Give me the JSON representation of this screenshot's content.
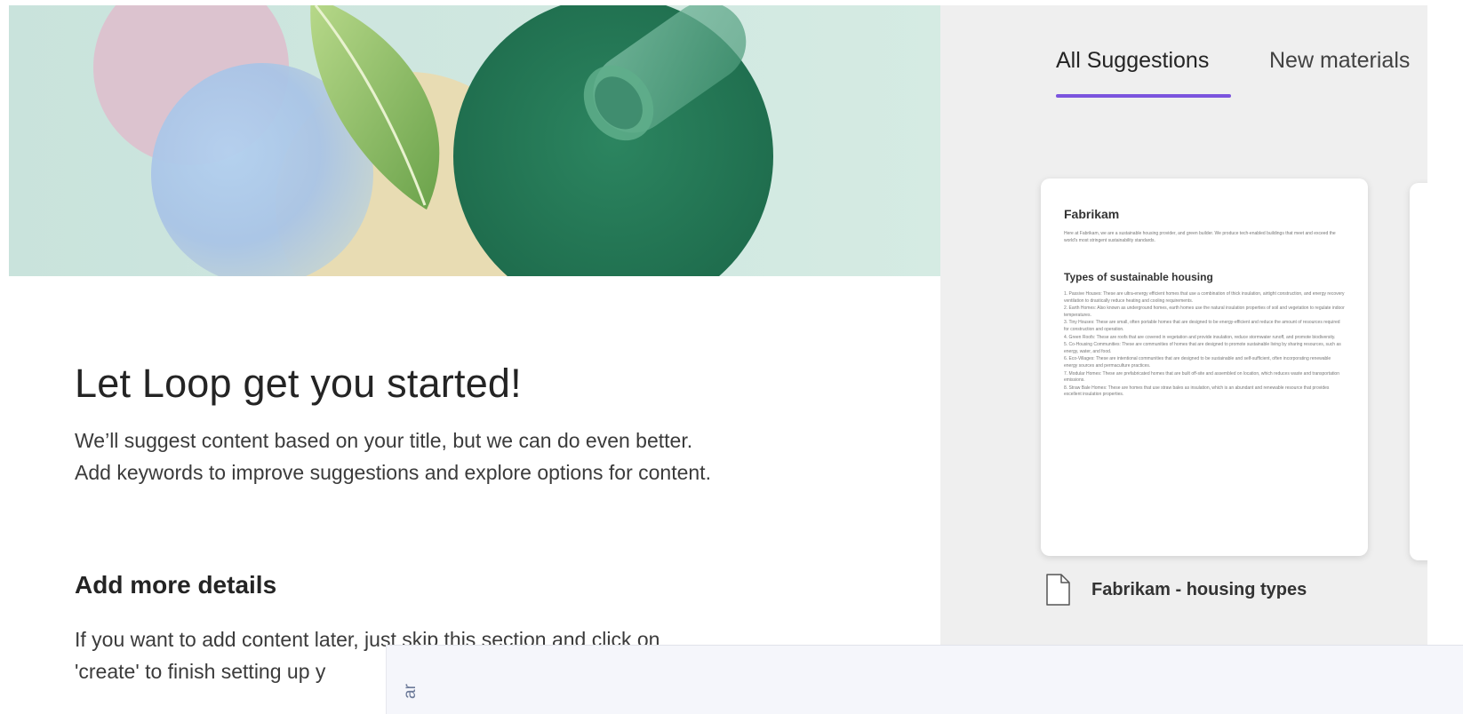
{
  "onboarding": {
    "headline": "Let Loop get you started!",
    "intro_line1": "We’ll suggest content based on your title, but we can do even better.",
    "intro_line2": "Add keywords to improve suggestions and explore options for content.",
    "section_title": "Add more details",
    "section_line1": "If you want to add content later, just skip this section and click on",
    "section_line2": "'create' to finish setting up y"
  },
  "suggestions": {
    "tabs": [
      {
        "label": "All Suggestions",
        "selected": true
      },
      {
        "label": "New materials",
        "selected": false
      }
    ],
    "accent_color": "#7b54de",
    "card": {
      "doc_title": "Fabrikam",
      "doc_intro": "Here at Fabrikam, we are a sustainable housing provider, and green builder. We produce tech-enabled buildings that meet and exceed the world's most stringent sustainability standards.",
      "doc_heading": "Types of sustainable housing",
      "doc_items": [
        "1. Passive Houses: These are ultra-energy efficient homes that use a combination of thick insulation, airtight construction, and energy recovery ventilation to drastically reduce heating and cooling requirements.",
        "2. Earth Homes: Also known as underground homes, earth homes use the natural insulation properties of soil and vegetation to regulate indoor temperatures.",
        "3. Tiny Houses: These are small, often portable homes that are designed to be energy-efficient and reduce the amount of resources required for construction and operation.",
        "4. Green Roofs: These are roofs that are covered in vegetation and provide insulation, reduce stormwater runoff, and promote biodiversity.",
        "5. Co-Housing Communities: These are communities of homes that are designed to promote sustainable living by sharing resources, such as energy, water, and food.",
        "6. Eco-Villages: These are intentional communities that are designed to be sustainable and self-sufficient, often incorporating renewable energy sources and permaculture practices.",
        "7. Modular Homes: These are prefabricated homes that are built off-site and assembled on location, which reduces waste and transportation emissions.",
        "8. Straw Bale Homes: These are homes that use straw bales as insulation, which is an abundant and renewable resource that provides excellent insulation properties."
      ],
      "file_icon": "document-icon",
      "file_name": "Fabrikam - housing types"
    }
  },
  "overlay": {
    "vertical_label": "ar"
  }
}
